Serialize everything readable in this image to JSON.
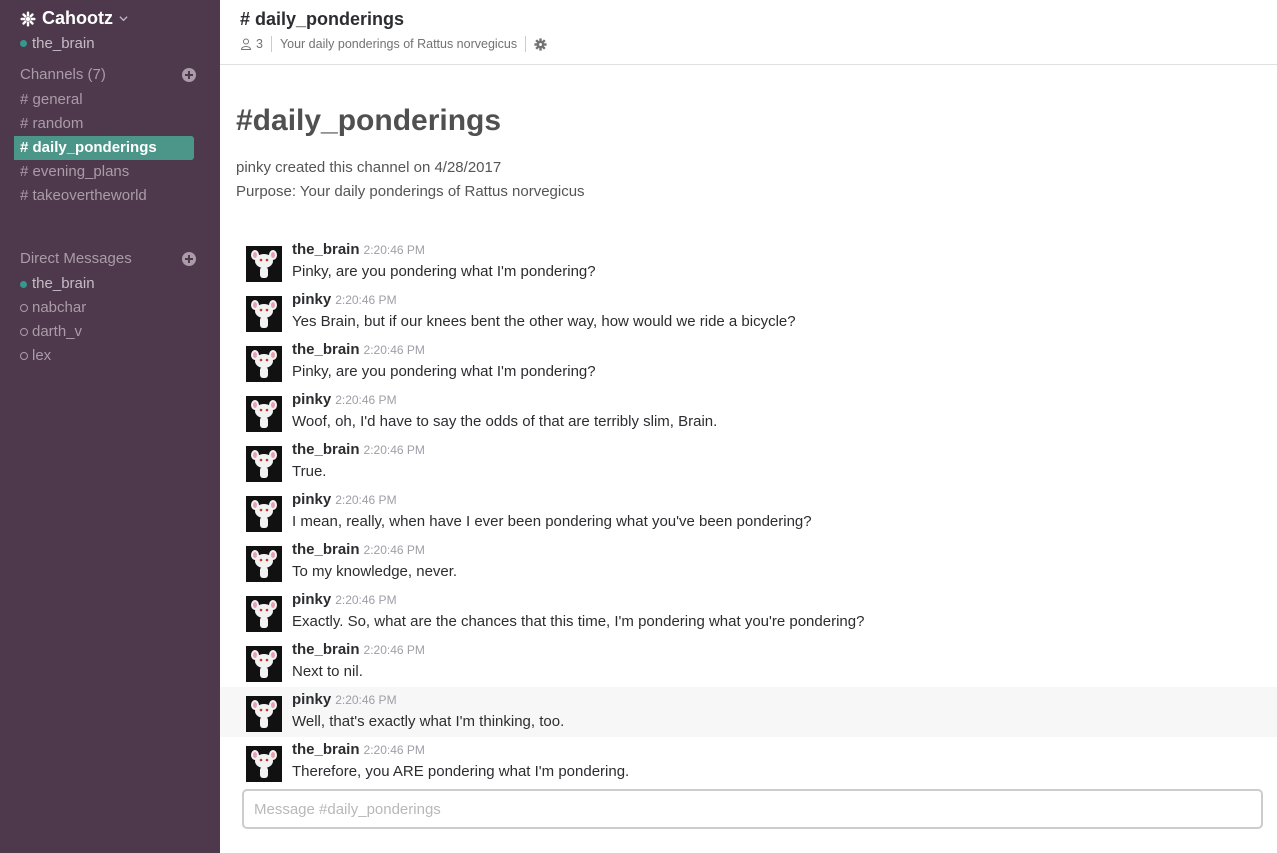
{
  "sidebar": {
    "team_name": "Cahootz",
    "current_user": "the_brain",
    "channels_heading": "Channels (7)",
    "channels": [
      "general",
      "random",
      "daily_ponderings",
      "evening_plans",
      "takeovertheworld"
    ],
    "active_channel_index": 2,
    "dms_heading": "Direct Messages",
    "dms": [
      {
        "name": "the_brain",
        "online": true
      },
      {
        "name": "nabchar",
        "online": false
      },
      {
        "name": "darth_v",
        "online": false
      },
      {
        "name": "lex",
        "online": false
      }
    ],
    "colors": {
      "background": "#4d394b",
      "active": "#4c9689",
      "presence": "#38978d"
    }
  },
  "header": {
    "title": "# daily_ponderings",
    "member_count": "3",
    "purpose": "Your daily ponderings of Rattus norvegicus"
  },
  "intro": {
    "title": "#daily_ponderings",
    "created": "pinky created this channel on 4/28/2017",
    "purpose": "Purpose: Your daily ponderings of Rattus norvegicus"
  },
  "messages": [
    {
      "author": "the_brain",
      "time": "2:20:46 PM",
      "text": "Pinky, are you pondering what I'm pondering?"
    },
    {
      "author": "pinky",
      "time": "2:20:46 PM",
      "text": "Yes Brain, but if our knees bent the other way, how would we ride a bicycle?"
    },
    {
      "author": "the_brain",
      "time": "2:20:46 PM",
      "text": "Pinky, are you pondering what I'm pondering?"
    },
    {
      "author": "pinky",
      "time": "2:20:46 PM",
      "text": "Woof, oh, I'd have to say the odds of that are terribly slim, Brain."
    },
    {
      "author": "the_brain",
      "time": "2:20:46 PM",
      "text": "True."
    },
    {
      "author": "pinky",
      "time": "2:20:46 PM",
      "text": "I mean, really, when have I ever been pondering what you've been pondering?"
    },
    {
      "author": "the_brain",
      "time": "2:20:46 PM",
      "text": "To my knowledge, never."
    },
    {
      "author": "pinky",
      "time": "2:20:46 PM",
      "text": "Exactly. So, what are the chances that this time, I'm pondering what you're pondering?"
    },
    {
      "author": "the_brain",
      "time": "2:20:46 PM",
      "text": "Next to nil."
    },
    {
      "author": "pinky",
      "time": "2:20:46 PM",
      "text": "Well, that's exactly what I'm thinking, too."
    },
    {
      "author": "the_brain",
      "time": "2:20:46 PM",
      "text": "Therefore, you ARE pondering what I'm pondering."
    }
  ],
  "composer": {
    "placeholder": "Message #daily_ponderings",
    "value": ""
  }
}
